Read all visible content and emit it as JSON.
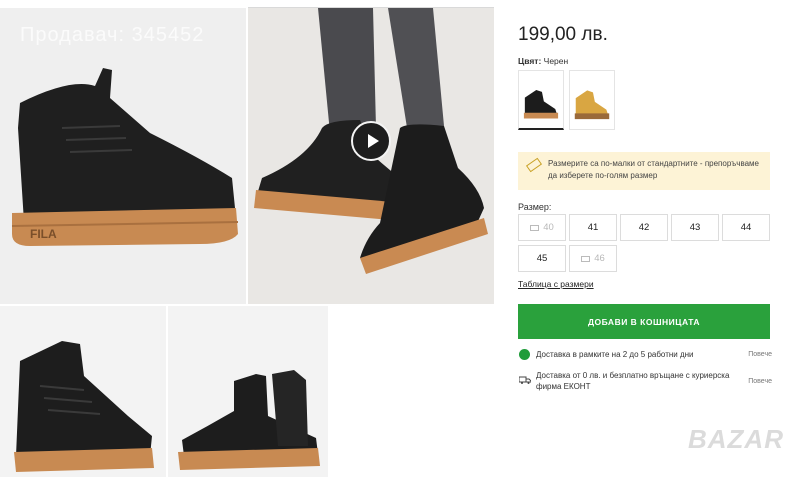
{
  "gallery": {
    "watermark": "Продавач: 345452",
    "play_icon": "play-icon"
  },
  "product": {
    "price": "199,00 лв.",
    "color_label": "Цвят:",
    "color_value": "Черен",
    "swatches": [
      {
        "name": "black",
        "color": "#1c1c1c"
      },
      {
        "name": "tan",
        "color": "#d9a642"
      }
    ]
  },
  "notice": {
    "icon": "ruler-icon",
    "text": "Размерите са по-малки от стандартните - препоръчваме да изберете по-голям размер"
  },
  "sizes": {
    "label": "Размер:",
    "options": [
      {
        "value": "40",
        "available": false
      },
      {
        "value": "41",
        "available": true
      },
      {
        "value": "42",
        "available": true
      },
      {
        "value": "43",
        "available": true
      },
      {
        "value": "44",
        "available": true
      },
      {
        "value": "45",
        "available": true
      },
      {
        "value": "46",
        "available": false
      }
    ],
    "table_link": "Таблица с размери"
  },
  "cart": {
    "button_label": "ДОБАВИ В КОШНИЦАТА"
  },
  "delivery": [
    {
      "icon": "status-dot-icon",
      "text": "Доставка в рамките на 2 до 5 работни дни",
      "more": "Повече"
    },
    {
      "icon": "truck-icon",
      "text": "Доставка от 0 лв. и безплатно връщане с куриерска фирма ЕКОНТ",
      "more": "Повече"
    }
  ],
  "brand_watermark": "BAZAR",
  "colors": {
    "accent_green": "#2aa13c",
    "notice_bg": "#fdf3d6",
    "sole": "#c9874f"
  }
}
